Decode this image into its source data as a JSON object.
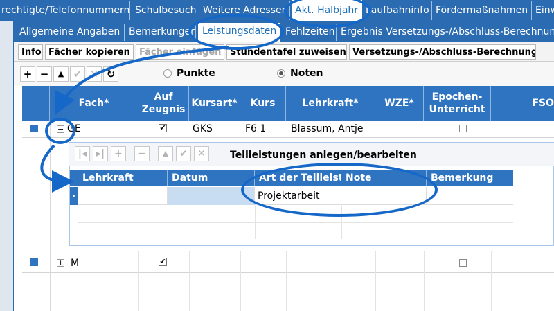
{
  "tabs_row1": [
    "rechtigte/Telefonnummern",
    "Schulbesuch",
    "Weitere Adressen",
    "Akt. Halbjahr",
    "Laufbahninfo",
    "Fördermaßnahmen",
    "Einw"
  ],
  "tabs_row2": [
    "Allgemeine Angaben",
    "Bemerkungen",
    "Leistungsdaten",
    "Fehlzeiten",
    "Ergebnis Versetzungs-/Abschluss-Berechnung"
  ],
  "sub_buttons": [
    "Info",
    "Fächer kopieren",
    "Fächer einfügen",
    "Stundentafel zuweisen",
    "Versetzungs-/Abschluss-Berechnung"
  ],
  "toolbar": {
    "radio_points": "Punkte",
    "radio_grades": "Noten",
    "selected": "Noten"
  },
  "grid": {
    "headers": [
      "Fach*",
      "Auf Zeugnis",
      "Kursart*",
      "Kurs",
      "Lehrkraft*",
      "WZE*",
      "Epochen-Unterricht",
      "FSO"
    ],
    "rows": [
      {
        "fach": "GE",
        "auf_zeugnis": true,
        "kursart": "GKS",
        "kurs": "F6 1",
        "lehrkraft": "Blassum, Antje",
        "epochen": false,
        "expanded": true
      },
      {
        "fach": "M",
        "auf_zeugnis": true,
        "kursart": "",
        "kurs": "",
        "lehrkraft": "",
        "epochen": false,
        "expanded": false
      }
    ]
  },
  "subgrid": {
    "title": "Teilleistungen anlegen/bearbeiten",
    "headers": [
      "Lehrkraft",
      "Datum",
      "Art der Teilleistu",
      "Note",
      "Bemerkung"
    ],
    "rows": [
      {
        "lehrkraft": "",
        "datum": "",
        "art": "Projektarbeit",
        "note": "",
        "bemerkung": ""
      }
    ]
  },
  "colors": {
    "tab_blue": "#2b6bb1",
    "header_blue": "#2f74c0",
    "annotation_blue": "#1668c8"
  }
}
